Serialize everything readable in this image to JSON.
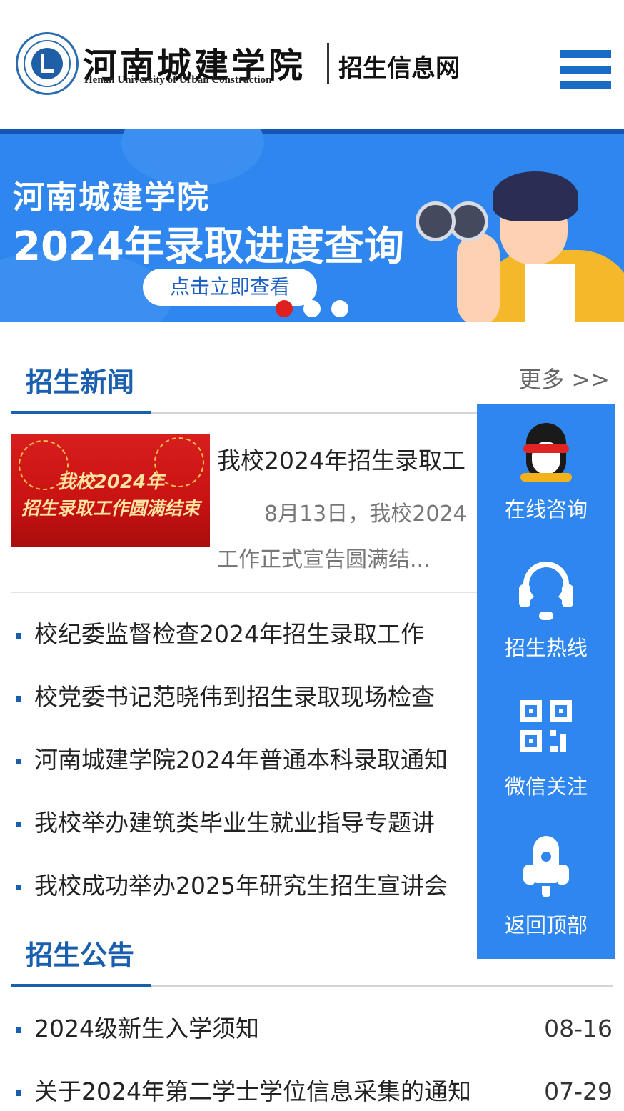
{
  "header": {
    "logo_cn": "河南城建学院",
    "logo_en": "Henan University of Urban Construction",
    "site_name": "招生信息网",
    "menu_icon": "hamburger-menu-icon"
  },
  "banner": {
    "line1": "河南城建学院",
    "line2": "2024年录取进度查询",
    "cta": "点击立即查看",
    "slides_total": 3,
    "active_slide": 1
  },
  "news": {
    "title": "招生新闻",
    "more": "更多 >>",
    "featured": {
      "image_line1": "我校2024年",
      "image_line2": "招生录取工作圆满结束",
      "title": "我校2024年招生录取工",
      "desc": "8月13日，我校2024工作正式宣告圆满结..."
    },
    "items": [
      "校纪委监督检查2024年招生录取工作",
      "校党委书记范晓伟到招生录取现场检查",
      "河南城建学院2024年普通本科录取通知",
      "我校举办建筑类毕业生就业指导专题讲",
      "我校成功举办2025年研究生招生宣讲会"
    ]
  },
  "notices": {
    "title": "招生公告",
    "items": [
      {
        "title": "2024级新生入学须知",
        "date": "08-16"
      },
      {
        "title": "关于2024年第二学士学位信息采集的通知",
        "date": "07-29"
      }
    ]
  },
  "side_panel": {
    "items": [
      {
        "label": "在线咨询",
        "icon": "qq-penguin-icon"
      },
      {
        "label": "招生热线",
        "icon": "headset-icon"
      },
      {
        "label": "微信关注",
        "icon": "qr-code-icon"
      },
      {
        "label": "返回顶部",
        "icon": "rocket-icon"
      }
    ]
  },
  "colors": {
    "brand_blue": "#1a5fad",
    "banner_blue": "#2e86ee",
    "side_panel": "#2f86ee",
    "active_dot": "#e01f1f"
  }
}
